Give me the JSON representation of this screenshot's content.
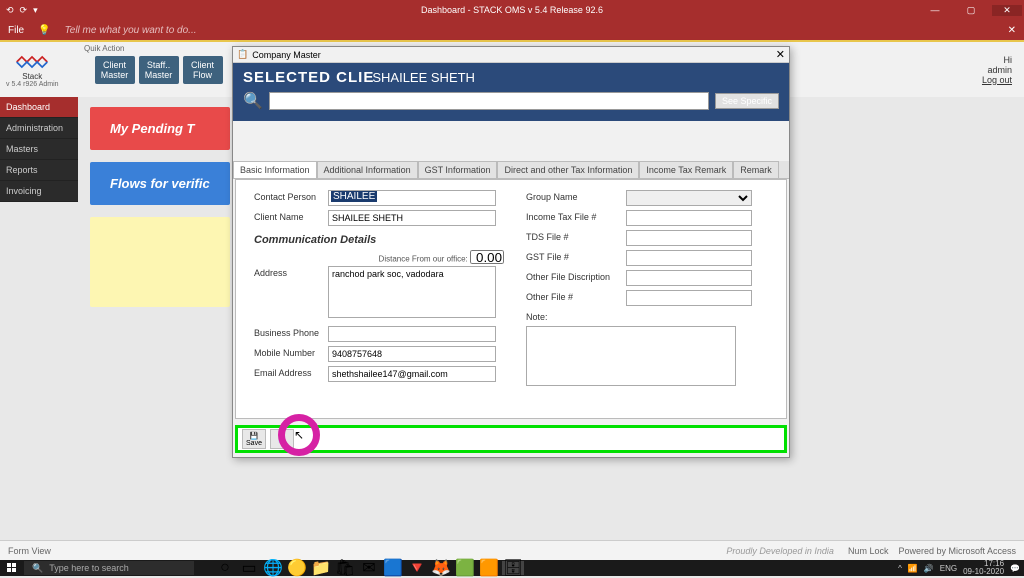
{
  "titlebar": {
    "title": "Dashboard - STACK OMS v 5.4 Release 92.6",
    "min": "—",
    "max": "▢",
    "close": "✕"
  },
  "ribbon": {
    "file": "File",
    "tellme": "Tell me what you want to do..."
  },
  "logo": {
    "name": "Stack",
    "sub": "v 5.4 r926 Admin"
  },
  "quik": {
    "hdr": "Quik Action",
    "btns": [
      "Client\nMaster",
      "Staff..\nMaster",
      "Client\nFlow"
    ]
  },
  "user": {
    "hi": "Hi",
    "name": "admin",
    "logout": "Log out"
  },
  "nav": {
    "items": [
      "Dashboard",
      "Administration",
      "Masters",
      "Reports",
      "Invoicing"
    ],
    "active": 0
  },
  "cards": {
    "red": "My Pending T",
    "blue": "Flows for verific"
  },
  "status": {
    "left": "Form View",
    "mid": "Proudly Developed in India",
    "numlock": "Num Lock",
    "powered": "Powered by Microsoft Access"
  },
  "taskbar": {
    "search": "Type here to search",
    "lang": "ENG",
    "time": "17:16",
    "date": "09-10-2020"
  },
  "dialog": {
    "title": "Company Master",
    "sel_label": "SELECTED CLIE",
    "sel_name": "SHAILEE SHETH",
    "see": "See Specific",
    "tabs": [
      "Basic Information",
      "Additional Information",
      "GST Information",
      "Direct and other Tax Information",
      "Income Tax Remark",
      "Remark"
    ],
    "active_tab": 0,
    "labels": {
      "contact": "Contact Person",
      "client": "Client Name",
      "comm": "Communication Details",
      "dist": "Distance From our office:",
      "addr": "Address",
      "bphone": "Business Phone",
      "mobile": "Mobile Number",
      "email": "Email Address",
      "group": "Group Name",
      "itfile": "Income Tax File #",
      "tds": "TDS File #",
      "gst": "GST File #",
      "ofd": "Other File Discription",
      "ofn": "Other File #",
      "note": "Note:"
    },
    "values": {
      "contact": "SHAILEE",
      "client": "SHAILEE SHETH",
      "dist": "0.00",
      "addr": "ranchod park soc, vadodara",
      "bphone": "",
      "mobile": "9408757648",
      "email": "shethshailee147@gmail.com",
      "group": "",
      "itfile": "",
      "tds": "",
      "gst": "",
      "ofd": "",
      "ofn": ""
    },
    "footer": {
      "save": "Save",
      "add": "A"
    }
  }
}
